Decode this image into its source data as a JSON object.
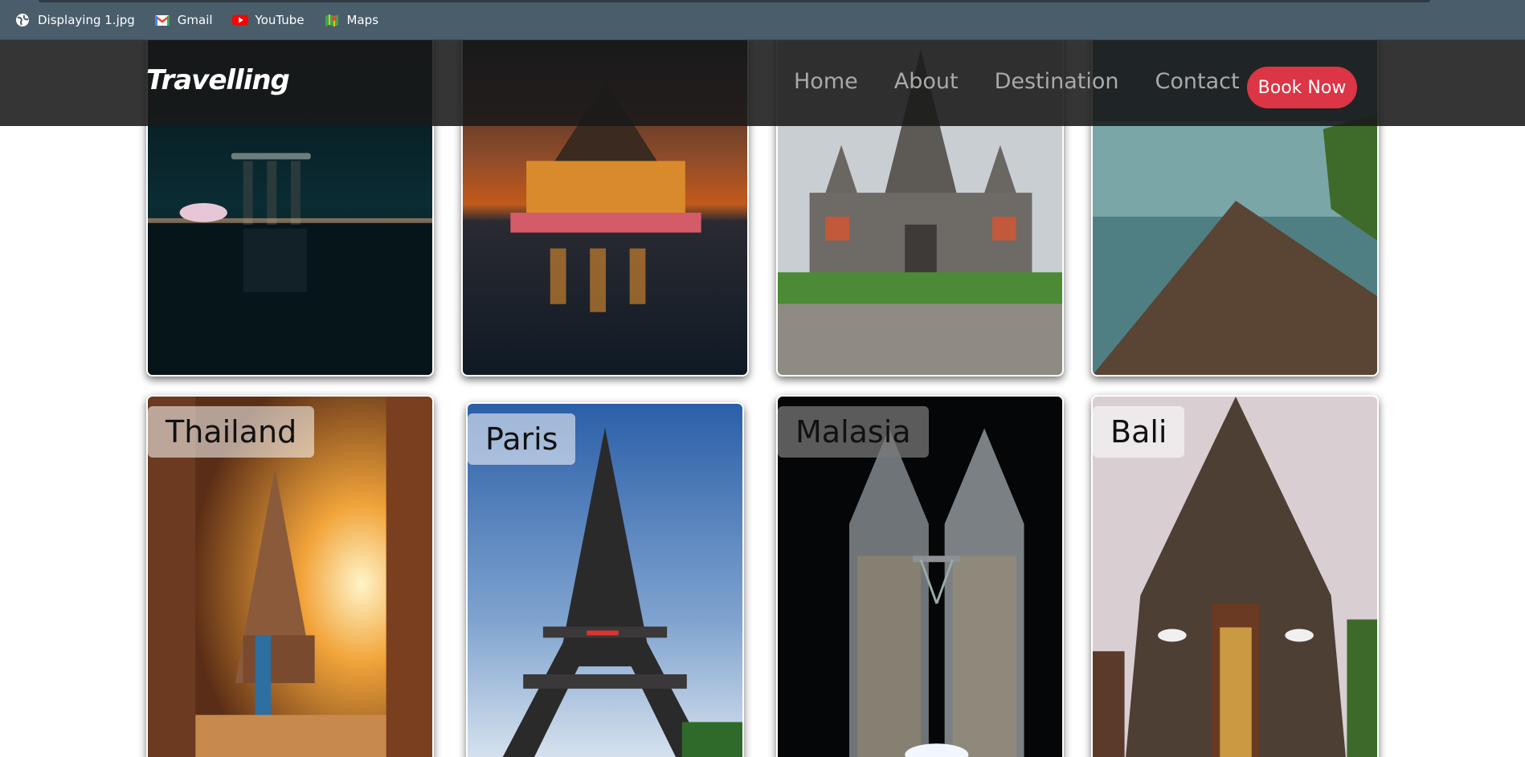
{
  "bookmarks": [
    {
      "label": "Displaying 1.jpg",
      "icon": "globe-icon"
    },
    {
      "label": "Gmail",
      "icon": "gmail-icon"
    },
    {
      "label": "YouTube",
      "icon": "youtube-icon"
    },
    {
      "label": "Maps",
      "icon": "maps-icon"
    }
  ],
  "navbar": {
    "brand": "Travelling",
    "links": [
      "Home",
      "About",
      "Destination",
      "Contact"
    ],
    "cta": "Book Now"
  },
  "gallery": {
    "row1": [
      {
        "name": "singapore-marina-bay-image"
      },
      {
        "name": "thai-temple-night-image"
      },
      {
        "name": "bali-temple-gate-image"
      },
      {
        "name": "lake-rock-image"
      }
    ],
    "row2": [
      {
        "label": "Thailand"
      },
      {
        "label": "Paris"
      },
      {
        "label": "Malasia"
      },
      {
        "label": "Bali"
      }
    ]
  },
  "colors": {
    "bookmarks_bg": "#4a5d6b",
    "navbar_bg": "#191919",
    "cta_bg": "#dc3545",
    "nav_link": "#a9a9a9"
  }
}
